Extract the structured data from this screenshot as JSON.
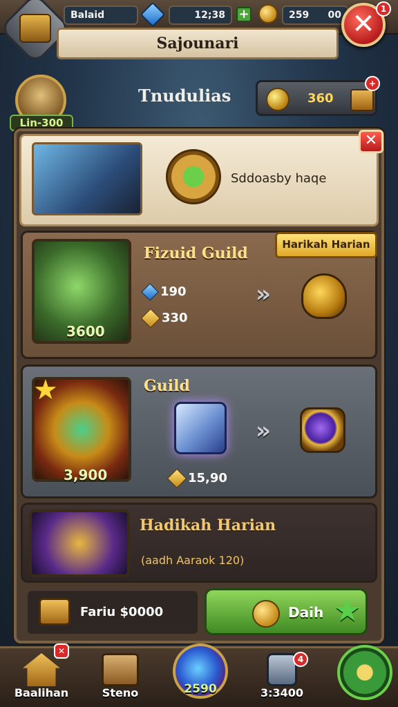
{
  "top_bar": {
    "profile_label": "Balaid",
    "gem_count": "12;38",
    "coin_count": "259",
    "extra_count": "00",
    "close_badge": "1"
  },
  "banner": {
    "title": "Sajounari"
  },
  "player": {
    "avatar_label": "Lin-300",
    "page_title": "Tnudulias",
    "gold_value": "360"
  },
  "featured": {
    "text": "Sddoasby haqe"
  },
  "cards": [
    {
      "title": "Fizuid Guild",
      "image_label": "3600",
      "gems": "190",
      "coins": "330",
      "tag": "Harikah Harian"
    },
    {
      "title": "Guild",
      "image_label": "3,900",
      "cost": "15,90"
    },
    {
      "title": "Hadikah Harian",
      "subtitle": "(aadh Aaraok 120)"
    }
  ],
  "footer": {
    "left_text": "Fariu $0000",
    "daily_label": "Daih"
  },
  "bottom_nav": [
    {
      "label": "Baalihan"
    },
    {
      "label": "Steno"
    },
    {
      "label": "2590"
    },
    {
      "label": "3:3400",
      "badge": "4"
    }
  ],
  "colors": {
    "accent_gold": "#ffe08a",
    "accent_green": "#4da43a",
    "danger_red": "#d92a2a"
  }
}
